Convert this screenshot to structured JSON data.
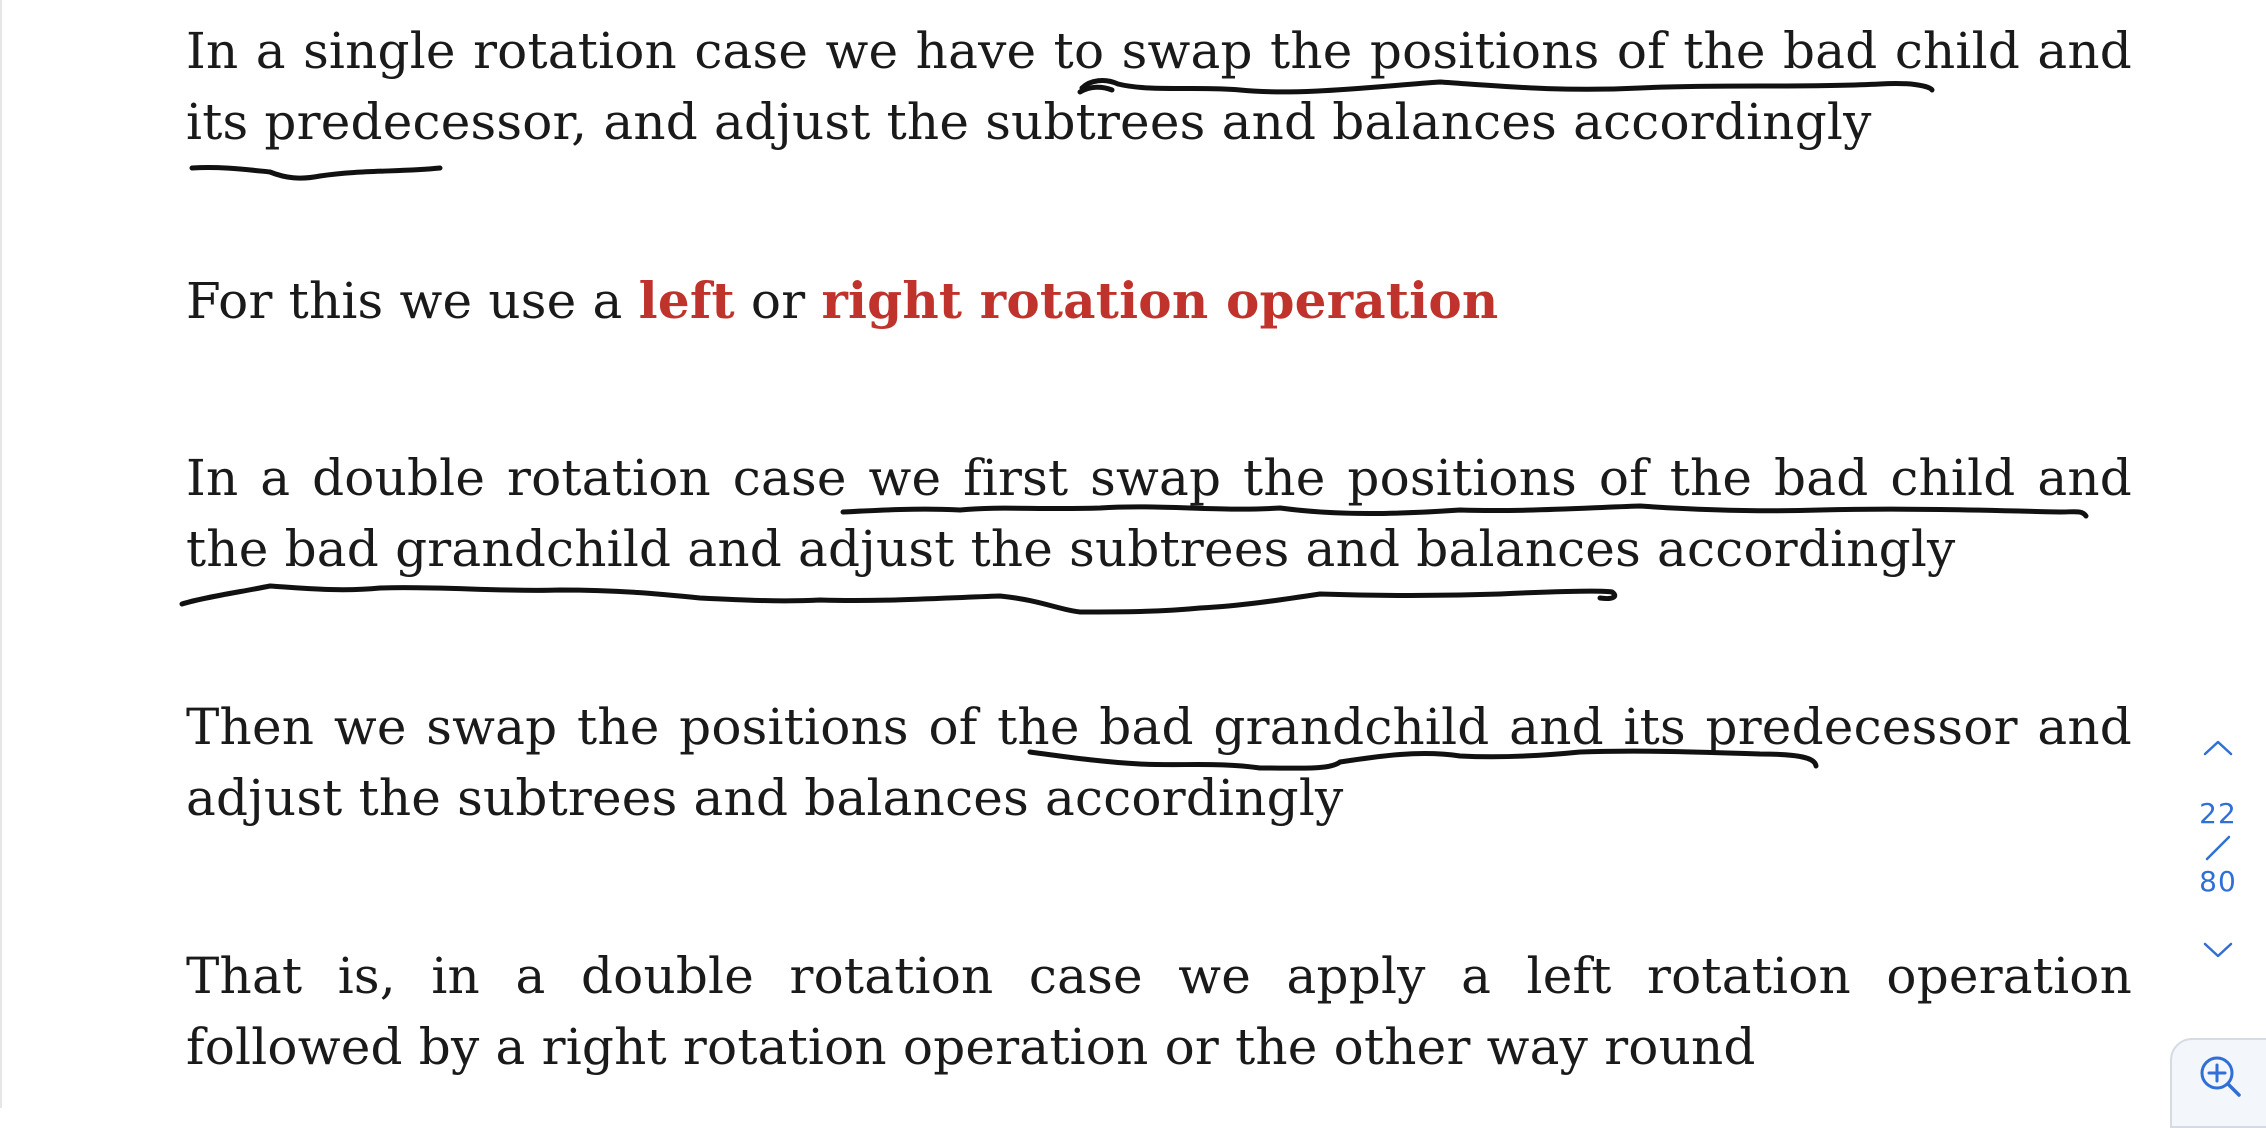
{
  "slide": {
    "p1": "In a single rotation case we have to swap the positions of the bad child and its predecessor, and adjust the subtrees and balances accordingly",
    "p2": {
      "prefix": "For this we use a ",
      "left": "left",
      "or": " or ",
      "right": "right rotation operation"
    },
    "p3": "In a double rotation case we first swap the positions of the bad child and the bad grandchild and adjust the subtrees and balances accordingly",
    "p4": "Then we swap the positions of the bad grandchild and its predecessor and adjust the subtrees and balances accordingly",
    "p5": "That is, in a double rotation case we apply a left rotation operation followed by a right rotation operation or the other way round"
  },
  "pager": {
    "current": "22",
    "total": "80",
    "up_icon": "chevron-up-icon",
    "down_icon": "chevron-down-icon"
  },
  "zoom": {
    "icon": "zoom-in-icon"
  },
  "colors": {
    "accent": "#c0332c",
    "pager": "#2f6fd6",
    "ink": "#111111"
  }
}
